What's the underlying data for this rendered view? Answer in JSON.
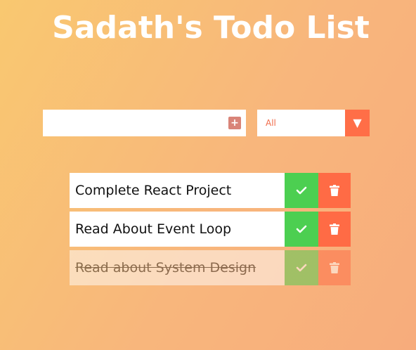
{
  "header": {
    "title": "Sadath's Todo List"
  },
  "form": {
    "input_value": "",
    "add_icon": "plus-square-icon",
    "filter": {
      "selected": "All",
      "arrow_icon": "caret-down-icon"
    }
  },
  "todos": [
    {
      "text": "Complete React Project",
      "completed": false
    },
    {
      "text": "Read About Event Loop",
      "completed": false
    },
    {
      "text": "Read about System Design",
      "completed": true
    }
  ],
  "colors": {
    "gradient_start": "#f9c870",
    "gradient_end": "#f7ac7c",
    "check": "#4ccf51",
    "trash": "#ff6b45",
    "accent_text": "#f06a48"
  }
}
